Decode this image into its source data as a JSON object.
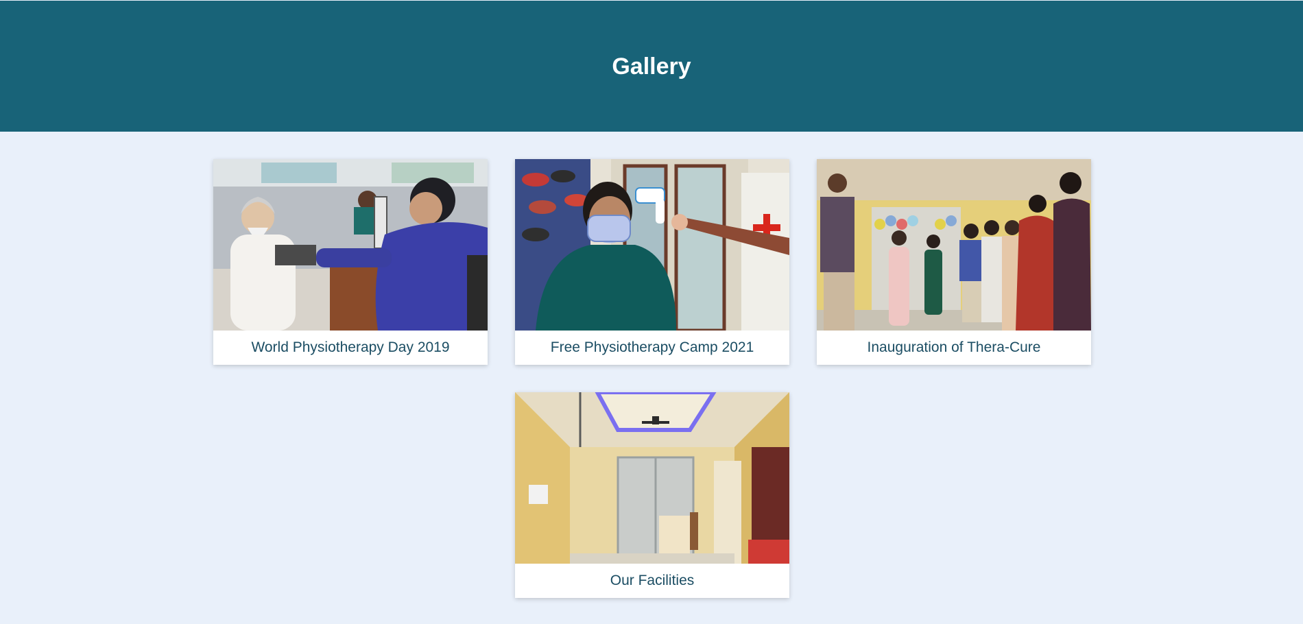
{
  "header": {
    "title": "Gallery",
    "background_color": "#186378"
  },
  "page": {
    "background_color": "#e9f0fa"
  },
  "gallery": {
    "items": [
      {
        "caption": "World Physiotherapy Day 2019",
        "image": "photo of a health check-up at a clinic desk"
      },
      {
        "caption": "Free Physiotherapy Camp 2021",
        "image": "photo of a masked woman having temperature checked"
      },
      {
        "caption": "Inauguration of Thera-Cure",
        "image": "photo of a group of people at an inauguration"
      },
      {
        "caption": "Our Facilities",
        "image": "photo of a clinic interior with reception desk"
      }
    ],
    "caption_color": "#1b4d63"
  }
}
